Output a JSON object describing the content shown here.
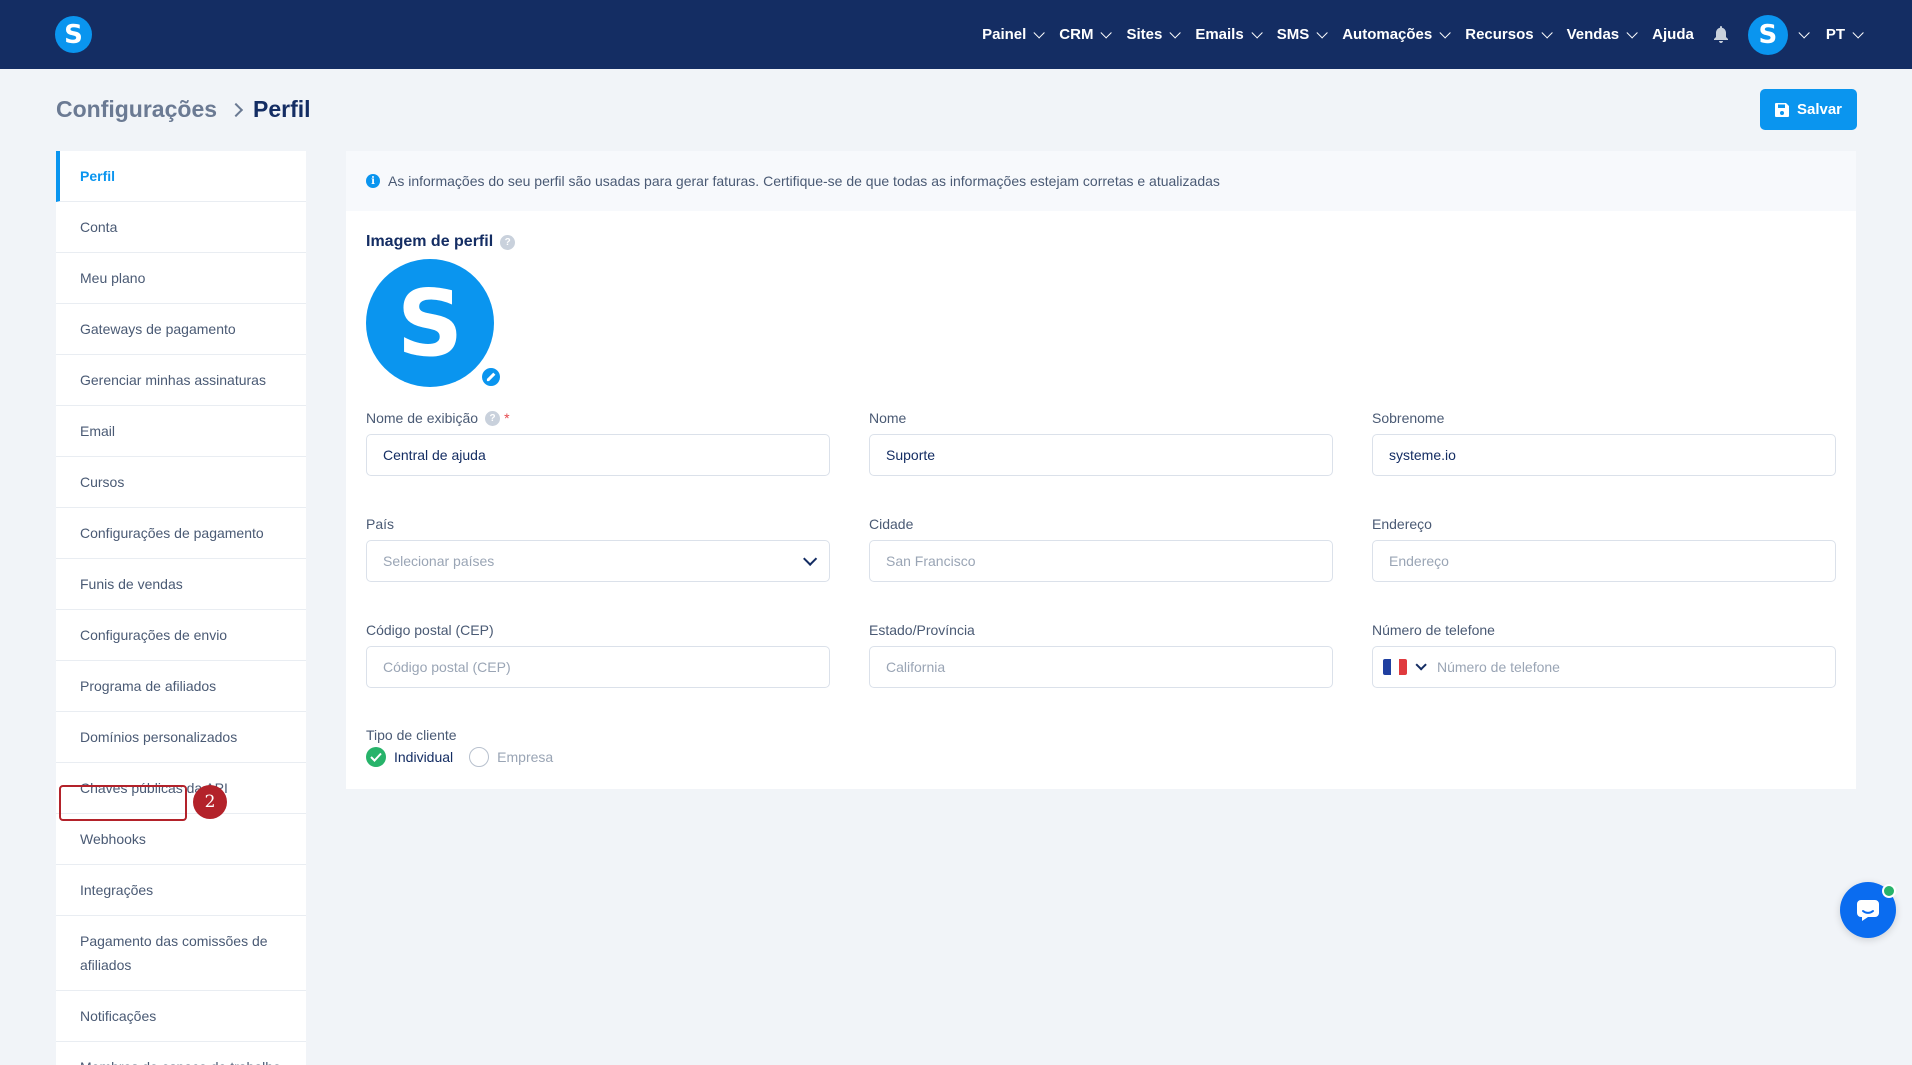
{
  "brand": {
    "logo_letter": "S",
    "accent": "#0a95ef",
    "nav_bg": "#142d63"
  },
  "nav": {
    "items": [
      {
        "label": "Painel"
      },
      {
        "label": "CRM"
      },
      {
        "label": "Sites"
      },
      {
        "label": "Emails"
      },
      {
        "label": "SMS"
      },
      {
        "label": "Automações"
      },
      {
        "label": "Recursos"
      },
      {
        "label": "Vendas"
      }
    ],
    "help": "Ajuda",
    "avatar_letter": "S",
    "language": "PT"
  },
  "breadcrumb": {
    "parent": "Configurações",
    "current": "Perfil"
  },
  "save_label": "Salvar",
  "sidebar": {
    "items": [
      {
        "label": "Perfil"
      },
      {
        "label": "Conta"
      },
      {
        "label": "Meu plano"
      },
      {
        "label": "Gateways de pagamento"
      },
      {
        "label": "Gerenciar minhas assinaturas"
      },
      {
        "label": "Email"
      },
      {
        "label": "Cursos"
      },
      {
        "label": "Configurações de pagamento"
      },
      {
        "label": "Funis de vendas"
      },
      {
        "label": "Configurações de envio"
      },
      {
        "label": "Programa de afiliados"
      },
      {
        "label": "Domínios personalizados"
      },
      {
        "label": "Chaves públicas da API"
      },
      {
        "label": "Webhooks"
      },
      {
        "label": "Integrações"
      },
      {
        "label": "Pagamento das comissões de afiliados"
      },
      {
        "label": "Notificações"
      },
      {
        "label": "Membros do espaço de trabalho"
      }
    ],
    "step_badge": "2"
  },
  "info": "As informações do seu perfil são usadas para gerar faturas. Certifique-se de que todas as informações estejam corretas e atualizadas",
  "profile_image": {
    "title": "Imagem de perfil",
    "help": "?",
    "avatar_letter": "S"
  },
  "fields": {
    "display_name": {
      "label": "Nome de exibição",
      "help": "?",
      "required": "*",
      "value": "Central de ajuda"
    },
    "first_name": {
      "label": "Nome",
      "value": "Suporte"
    },
    "last_name": {
      "label": "Sobrenome",
      "value": "systeme.io"
    },
    "country": {
      "label": "País",
      "placeholder": "Selecionar países"
    },
    "city": {
      "label": "Cidade",
      "placeholder": "San Francisco"
    },
    "address": {
      "label": "Endereço",
      "placeholder": "Endereço"
    },
    "postal_code": {
      "label": "Código postal (CEP)",
      "placeholder": "Código postal (CEP)"
    },
    "state": {
      "label": "Estado/Província",
      "placeholder": "California"
    },
    "phone": {
      "label": "Número de telefone",
      "placeholder": "Número de telefone",
      "flag": "france-flag-icon"
    }
  },
  "client_type": {
    "label": "Tipo de cliente",
    "options": [
      {
        "label": "Individual",
        "selected": true
      },
      {
        "label": "Empresa",
        "selected": false
      }
    ]
  },
  "icons": {
    "bell": "bell-icon",
    "save": "floppy-disk-icon",
    "edit": "pencil-icon",
    "info": "info-icon",
    "chat": "chat-bubble-icon"
  }
}
